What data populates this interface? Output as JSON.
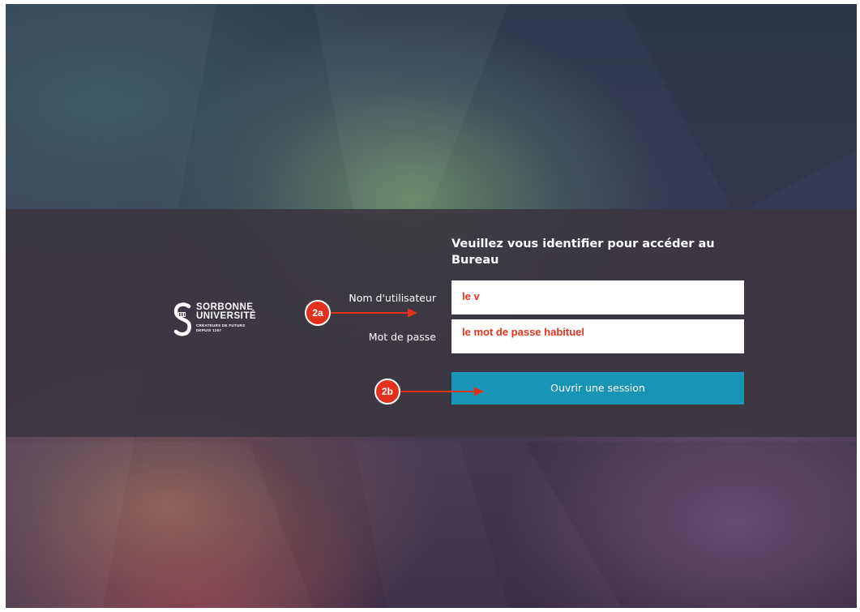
{
  "login": {
    "heading": "Veuillez vous identifier pour accéder au Bureau",
    "username_label": "Nom d'utilisateur",
    "username_value": "le v",
    "password_label": "Mot de passe",
    "password_value": "le mot de passe habituel",
    "submit_label": "Ouvrir une session"
  },
  "logo": {
    "line1": "SORBONNE",
    "line2": "UNIVERSITÉ",
    "tagline1": "CRÉATEURS DE FUTURS",
    "tagline2": "DEPUIS 1257"
  },
  "annotations": {
    "step_a": "2a",
    "step_b": "2b"
  },
  "colors": {
    "button": "#1895b6",
    "annotation": "#e2321d",
    "input_text": "#e8321e",
    "band": "#3c3741"
  }
}
